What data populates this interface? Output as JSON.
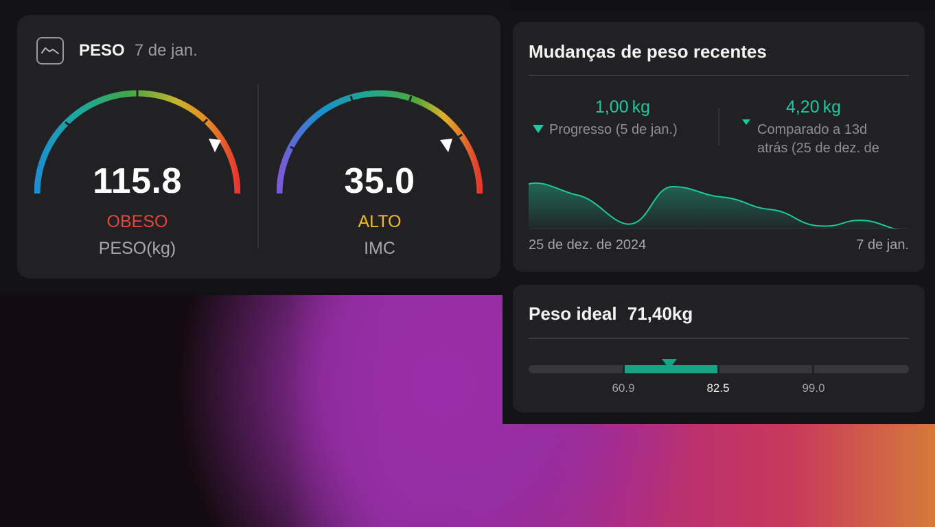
{
  "peso_card": {
    "title": "PESO",
    "date": "7 de jan.",
    "icon": "chart-line-icon",
    "weight_gauge": {
      "value": "115.8",
      "status": "OBESO",
      "status_color": "#e2463d",
      "label": "PESO(kg)",
      "level": 0.82
    },
    "bmi_gauge": {
      "value": "35.0",
      "status": "ALTO",
      "status_color": "#f0b92b",
      "label": "IMC",
      "level": 0.82
    }
  },
  "changes_card": {
    "title": "Mudanças de peso recentes",
    "progress": {
      "value": "1,00 kg",
      "caption": "Progresso (5 de jan.)"
    },
    "comparison": {
      "value": "4,20 kg",
      "caption_line1": "Comparado a 13d",
      "caption_line2": "atrás (25 de dez. de"
    },
    "axis_start": "25 de dez. de 2024",
    "axis_end": "7 de jan.",
    "accent_color": "#1fc7a0"
  },
  "ideal_card": {
    "title": "Peso ideal",
    "value": "71,40kg",
    "ticks": [
      "60.9",
      "82.5",
      "99.0"
    ]
  }
}
